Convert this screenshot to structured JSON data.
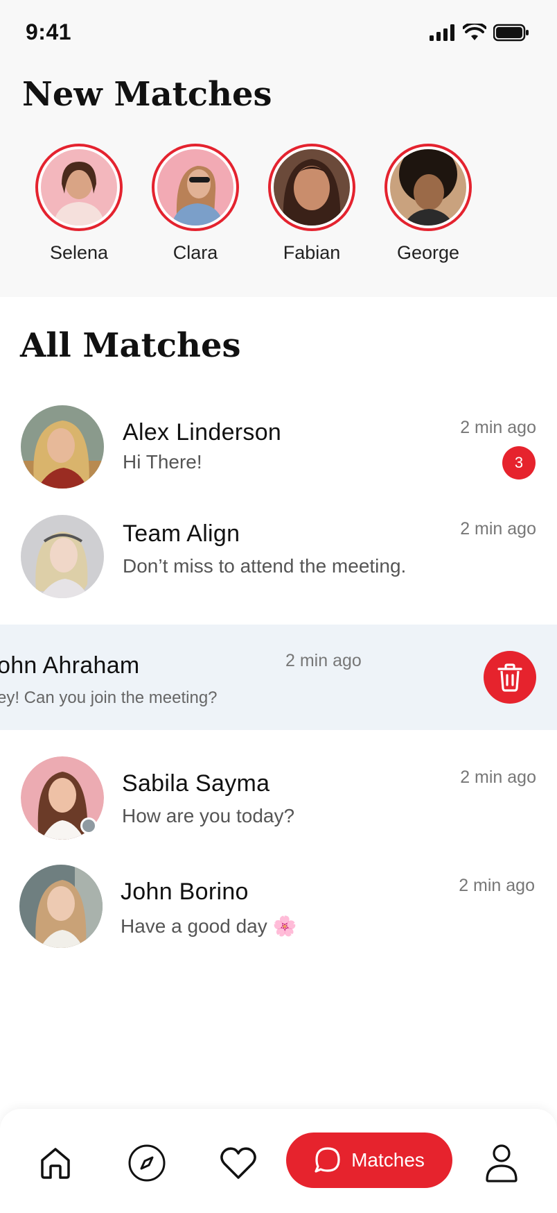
{
  "status": {
    "time": "9:41"
  },
  "new_matches": {
    "title": "New Matches",
    "items": [
      {
        "name": "Selena"
      },
      {
        "name": "Clara"
      },
      {
        "name": "Fabian"
      },
      {
        "name": "George"
      }
    ]
  },
  "all_matches": {
    "title": "All Matches",
    "items": [
      {
        "name": "Alex Linderson",
        "message": "Hi There!",
        "time": "2 min ago",
        "unread": "3"
      },
      {
        "name": "Team Align",
        "message": "Don’t miss to attend the meeting.",
        "time": "2 min ago"
      },
      {
        "name": "ohn Ahraham",
        "message": "ey! Can you join the meeting?",
        "time": "2 min ago"
      },
      {
        "name": "Sabila Sayma",
        "message": "How are you today?",
        "time": "2 min ago"
      },
      {
        "name": "John Borino",
        "message": "Have a good day 🌸",
        "time": "2 min ago"
      }
    ]
  },
  "nav": {
    "active_label": "Matches"
  },
  "colors": {
    "accent": "#e6232d",
    "ring": "#e4232f"
  }
}
